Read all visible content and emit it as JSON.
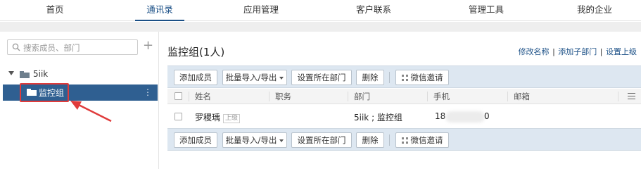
{
  "nav": {
    "tabs": [
      {
        "label": "首页"
      },
      {
        "label": "通讯录"
      },
      {
        "label": "应用管理"
      },
      {
        "label": "客户联系"
      },
      {
        "label": "管理工具"
      },
      {
        "label": "我的企业"
      }
    ],
    "active_index": 1,
    "accent_color": "#1a4f86"
  },
  "sidebar": {
    "search_placeholder": "搜索成员、部门",
    "add_icon": "plus-icon",
    "tree": {
      "root_label": "5iik",
      "selected_label": "监控组",
      "selected_bg": "#2f5f91",
      "annotation_color": "#e03b3b"
    }
  },
  "main": {
    "title": "监控组(1人)",
    "links": {
      "rename": "修改名称",
      "add_sub": "添加子部门",
      "set_parent": "设置上级",
      "separator": "|"
    },
    "toolbar": {
      "add_member": "添加成员",
      "batch_io": "批量导入/导出",
      "set_dept": "设置所在部门",
      "delete": "删除",
      "wechat_invite": "微信邀请"
    },
    "table": {
      "headers": [
        "姓名",
        "职务",
        "部门",
        "手机",
        "邮箱"
      ],
      "rows": [
        {
          "name": "罗稷瑀",
          "tag": "上级",
          "title": "",
          "dept": "5iik ; 监控组",
          "phone_prefix": "18",
          "phone_suffix": "0",
          "email": ""
        }
      ]
    }
  }
}
